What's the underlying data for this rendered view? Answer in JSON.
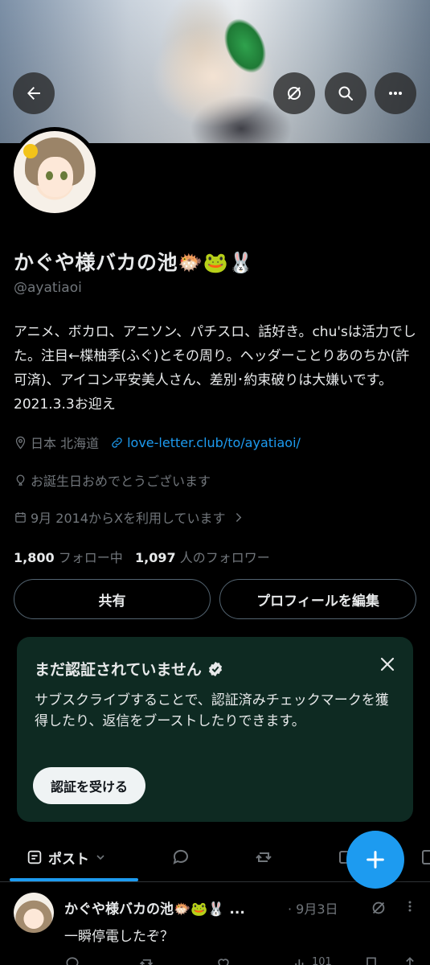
{
  "profile": {
    "name": "かぐや様バカの池🐡🐸🐰",
    "handle": "@ayatiaoi",
    "bio": "アニメ、ボカロ、アニソン、パチスロ、話好き。chu'sは活力でした。注目←楪柚季(ふぐ)とその周り。ヘッダーことりあのちか(許可済)、アイコン平安美人さん、差別･約束破りは大嫌いです。2021.3.3お迎え",
    "location": "日本 北海道",
    "website": "love-letter.club/to/ayatiaoi/",
    "birthday": "お誕生日おめでとうございます",
    "joined": "9月 2014からXを利用しています",
    "following_count": "1,800",
    "following_label": "フォロー中",
    "followers_count": "1,097",
    "followers_label": "人のフォロワー"
  },
  "actions": {
    "share": "共有",
    "edit_profile": "プロフィールを編集"
  },
  "verify_card": {
    "title": "まだ認証されていません",
    "text": "サブスクライブすることで、認証済みチェックマークを獲得したり、返信をブーストしたりできます。",
    "button": "認証を受ける"
  },
  "tabs": {
    "posts": "ポスト"
  },
  "post": {
    "author": "かぐや様バカの池🐡🐸🐰 ...",
    "date": "· 9月3日",
    "text": "一瞬停電したぞ？",
    "views": "101"
  },
  "colors": {
    "accent": "#1d9bf0",
    "muted": "#71767b",
    "card_bg": "#0e2a22"
  }
}
